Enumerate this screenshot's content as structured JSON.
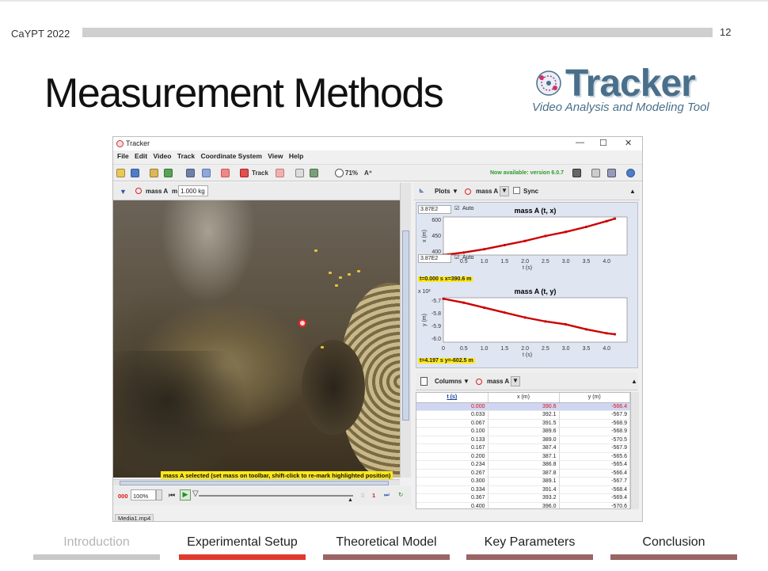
{
  "slide": {
    "conference": "CaYPT 2022",
    "page_number": "12",
    "title": "Measurement Methods"
  },
  "logo": {
    "brand": "Tracker",
    "tagline": "Video Analysis and Modeling Tool"
  },
  "app": {
    "window_title": "Tracker",
    "window_buttons": [
      "—",
      "☐",
      "✕"
    ],
    "menu": [
      "File",
      "Edit",
      "Video",
      "Track",
      "Coordinate System",
      "View",
      "Help"
    ],
    "toolbar": {
      "track_label": "Track",
      "zoom": "71%",
      "new_version": "Now available: version 6.0.7"
    },
    "video_panel": {
      "track_name": "mass A",
      "mass_label": "m",
      "mass_value": "1.000 kg",
      "status_message": "mass A selected (set mass on toolbar, shift-click to re-mark highlighted position)",
      "frame_number": "000",
      "zoom_value": "100%",
      "step_value": "1",
      "media_tab": "Media1.mp4"
    },
    "plots_panel": {
      "plots_label": "Plots",
      "track_name": "mass A",
      "sync_label": "Sync",
      "scale_top": "3.87E2",
      "scale_bottom": "3.87E2",
      "auto_label": "Auto",
      "x_plot": {
        "title": "mass A (t, x)",
        "ylabel": "x (m)",
        "xlabel": "t (s)",
        "yticks": [
          "600",
          "450",
          "400"
        ],
        "xticks": [
          "0",
          "0.5",
          "1.0",
          "1.5",
          "2.0",
          "2.5",
          "3.0",
          "3.5",
          "4.0"
        ],
        "readout": "t=0.000 s  x=390.6 m"
      },
      "y_plot": {
        "title": "mass A (t, y)",
        "ylabel": "y (m)",
        "xlabel": "t (s)",
        "multiplier": "x 10²",
        "yticks": [
          "-5.7",
          "-5.8",
          "-5.9",
          "-6.0"
        ],
        "xticks": [
          "0",
          "0.5",
          "1.0",
          "1.5",
          "2.0",
          "2.5",
          "3.0",
          "3.5",
          "4.0"
        ],
        "readout": "t=4.197 s  y=-602.5 m"
      }
    },
    "table_panel": {
      "columns_label": "Columns",
      "track_name": "mass A",
      "headers": [
        "t (s)",
        "x (m)",
        "y (m)"
      ],
      "rows": [
        [
          "0.000",
          "390.6",
          "-566.4"
        ],
        [
          "0.033",
          "392.1",
          "-567.9"
        ],
        [
          "0.067",
          "391.5",
          "-568.9"
        ],
        [
          "0.100",
          "389.6",
          "-568.9"
        ],
        [
          "0.133",
          "389.0",
          "-570.5"
        ],
        [
          "0.167",
          "387.4",
          "-567.9"
        ],
        [
          "0.200",
          "387.1",
          "-565.6"
        ],
        [
          "0.234",
          "386.8",
          "-565.4"
        ],
        [
          "0.267",
          "387.8",
          "-566.4"
        ],
        [
          "0.300",
          "389.1",
          "-567.7"
        ],
        [
          "0.334",
          "391.4",
          "-568.4"
        ],
        [
          "0.367",
          "393.2",
          "-569.4"
        ],
        [
          "0.400",
          "396.0",
          "-570.6"
        ]
      ]
    }
  },
  "chart_data": [
    {
      "type": "line",
      "title": "mass A (t, x)",
      "xlabel": "t (s)",
      "ylabel": "x (m)",
      "xlim": [
        0,
        4.5
      ],
      "ylim": [
        390,
        620
      ],
      "series": [
        {
          "name": "mass A",
          "x": [
            0.0,
            0.5,
            1.0,
            1.5,
            2.0,
            2.5,
            3.0,
            3.5,
            4.0,
            4.2
          ],
          "y": [
            390,
            405,
            425,
            450,
            475,
            505,
            530,
            560,
            595,
            610
          ]
        }
      ]
    },
    {
      "type": "line",
      "title": "mass A (t, y)",
      "xlabel": "t (s)",
      "ylabel": "y (m)",
      "xlim": [
        0,
        4.5
      ],
      "ylim": [
        -610,
        -565
      ],
      "series": [
        {
          "name": "mass A",
          "x": [
            0.0,
            0.5,
            1.0,
            1.5,
            2.0,
            2.5,
            3.0,
            3.5,
            4.0,
            4.2
          ],
          "y": [
            -566,
            -570,
            -575,
            -580,
            -585,
            -589,
            -592,
            -597,
            -601,
            -602
          ]
        }
      ]
    }
  ],
  "footer_nav": {
    "items": [
      {
        "label": "Introduction",
        "color": "#c8c8c8",
        "text_color": "#b5b5b5"
      },
      {
        "label": "Experimental Setup",
        "color": "#e03a2f",
        "text_color": "#222222"
      },
      {
        "label": "Theoretical Model",
        "color": "#9a6565",
        "text_color": "#222222"
      },
      {
        "label": "Key Parameters",
        "color": "#9a6565",
        "text_color": "#222222"
      },
      {
        "label": "Conclusion",
        "color": "#9a6565",
        "text_color": "#222222"
      }
    ]
  }
}
